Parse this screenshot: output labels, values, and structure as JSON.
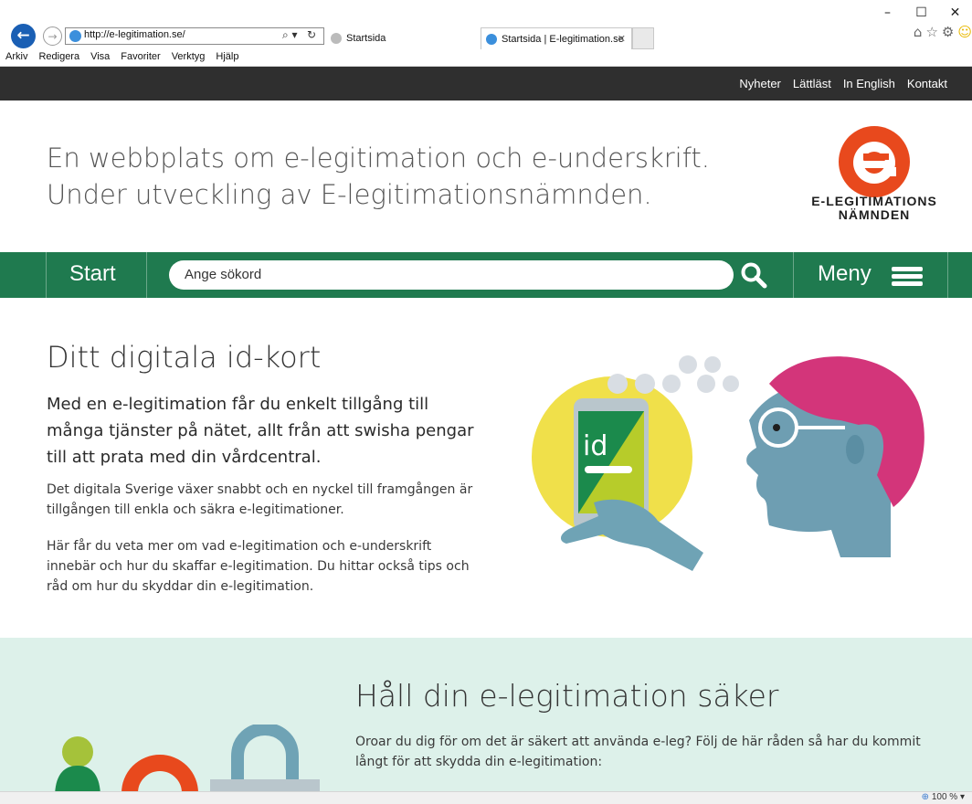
{
  "browser": {
    "url": "http://e-legitimation.se/",
    "tabs": [
      {
        "label": "Startsida"
      },
      {
        "label": "Startsida | E-legitimation.se"
      }
    ],
    "menu": [
      "Arkiv",
      "Redigera",
      "Visa",
      "Favoriter",
      "Verktyg",
      "Hjälp"
    ],
    "zoom": "100 %"
  },
  "topnav": {
    "links": [
      "Nyheter",
      "Lättläst",
      "In English",
      "Kontakt"
    ]
  },
  "header": {
    "tagline_line1": "En webbplats om e-legitimation och e-underskrift.",
    "tagline_line2": "Under utveckling av E-legitimationsnämnden.",
    "logo_line1": "E-LEGITIMATIONS",
    "logo_line2": "NÄMNDEN"
  },
  "greennav": {
    "start_label": "Start",
    "search_placeholder": "Ange sökord",
    "menu_label": "Meny"
  },
  "hero": {
    "title": "Ditt digitala id-kort",
    "lead": "Med en e-legitimation får du enkelt tillgång till många tjänster på nätet, allt från att swisha pengar till att prata med din vårdcentral.",
    "p1": "Det digitala Sverige växer snabbt och en nyckel till framgången är tillgången till enkla och säkra e-legitimationer.",
    "p2": "Här får du veta mer om vad e-legitimation och e-underskrift innebär och hur du skaffar e-legitimation. Du hittar också tips och råd om hur du skyddar din e-legitimation.",
    "card_text": "id"
  },
  "safe": {
    "title": "Håll din e-legitimation säker",
    "text": "Oroar du dig för om det är säkert att använda e-leg? Följ de här råden så har du kommit långt för att skydda din e-legitimation:"
  },
  "colors": {
    "green": "#1f7a4f",
    "topbar": "#2f2f2f",
    "logo_orange": "#e8491d",
    "safe_bg": "#ddf1ea"
  }
}
